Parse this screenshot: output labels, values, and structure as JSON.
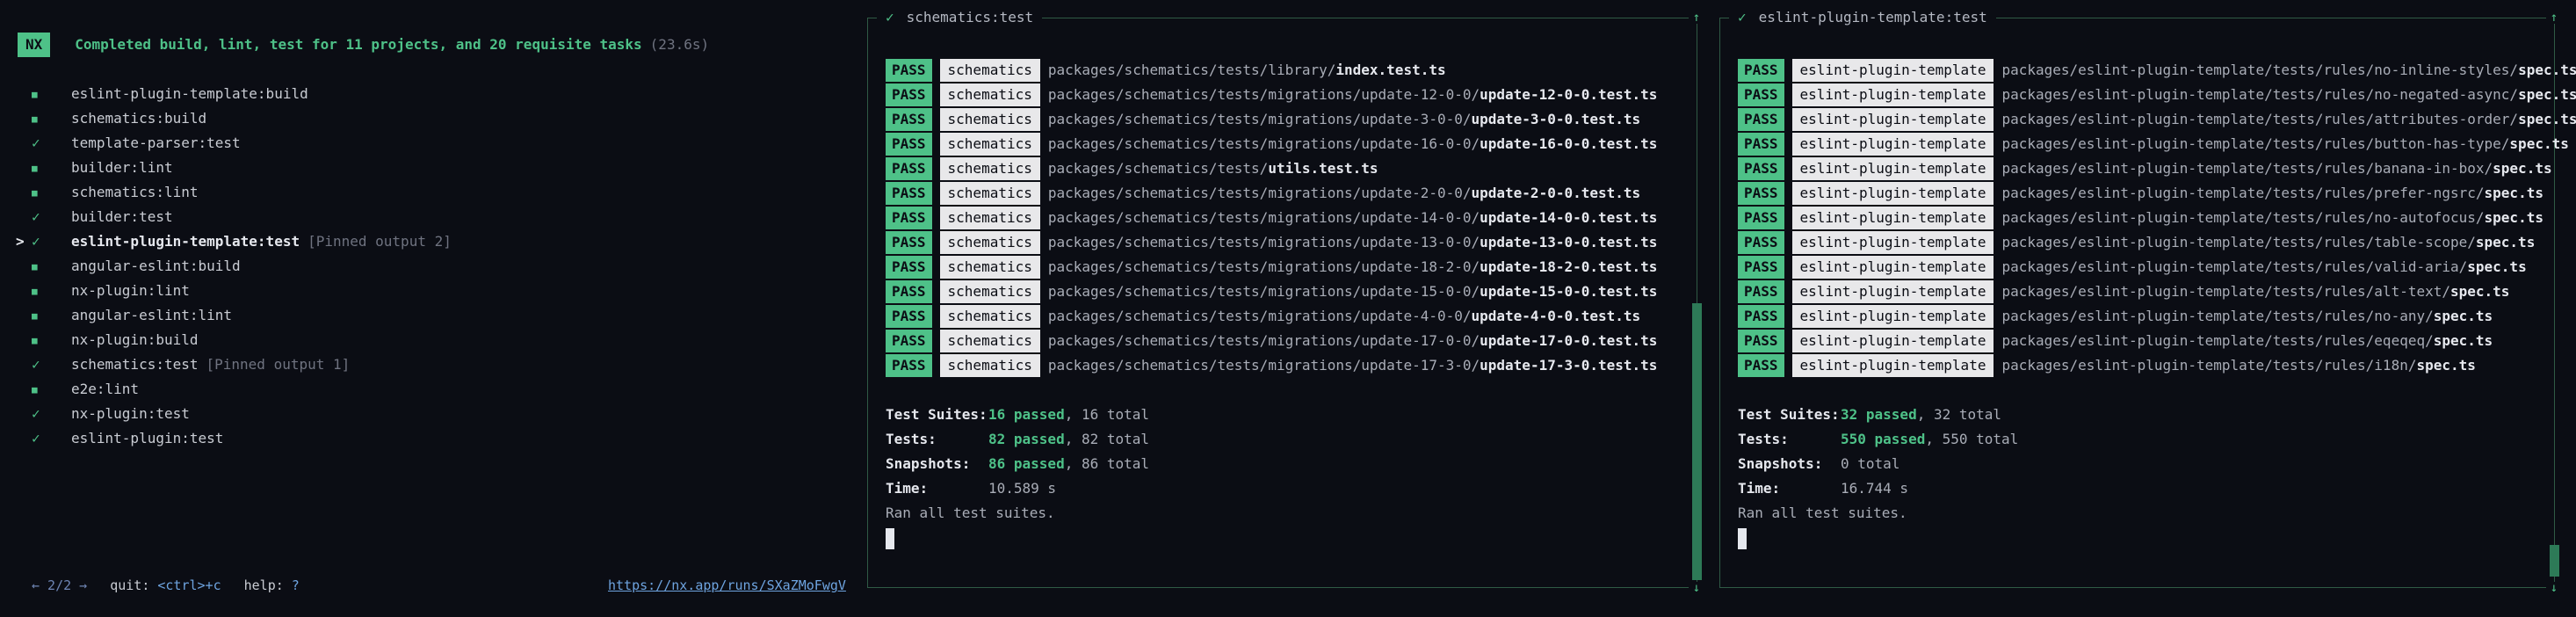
{
  "header": {
    "badge": "NX",
    "message": "Completed build, lint, test for 11 projects, and 20 requisite tasks",
    "duration": "(23.6s)"
  },
  "tasks": [
    {
      "name": "eslint-plugin-template:build",
      "status": "square",
      "pointer": "",
      "pinned": ""
    },
    {
      "name": "schematics:build",
      "status": "square",
      "pointer": "",
      "pinned": ""
    },
    {
      "name": "template-parser:test",
      "status": "check",
      "pointer": "",
      "pinned": ""
    },
    {
      "name": "builder:lint",
      "status": "square",
      "pointer": "",
      "pinned": ""
    },
    {
      "name": "schematics:lint",
      "status": "square",
      "pointer": "",
      "pinned": ""
    },
    {
      "name": "builder:test",
      "status": "check",
      "pointer": "",
      "pinned": ""
    },
    {
      "name": "eslint-plugin-template:test",
      "status": "check",
      "pointer": ">",
      "pinned": "[Pinned output 2]",
      "selected": true
    },
    {
      "name": "angular-eslint:build",
      "status": "square",
      "pointer": "",
      "pinned": ""
    },
    {
      "name": "nx-plugin:lint",
      "status": "square",
      "pointer": "",
      "pinned": ""
    },
    {
      "name": "angular-eslint:lint",
      "status": "square",
      "pointer": "",
      "pinned": ""
    },
    {
      "name": "nx-plugin:build",
      "status": "square",
      "pointer": "",
      "pinned": ""
    },
    {
      "name": "schematics:test",
      "status": "check",
      "pointer": "",
      "pinned": "[Pinned output 1]"
    },
    {
      "name": "e2e:lint",
      "status": "square",
      "pointer": "",
      "pinned": ""
    },
    {
      "name": "nx-plugin:test",
      "status": "check",
      "pointer": "",
      "pinned": ""
    },
    {
      "name": "eslint-plugin:test",
      "status": "check",
      "pointer": "",
      "pinned": ""
    }
  ],
  "footer": {
    "nav": "← 2/2 →",
    "quit_label": "quit:",
    "quit_key": "<ctrl>+c",
    "help_label": "help:",
    "help_key": "?",
    "run_url": "https://nx.app/runs/SXaZMoFwgV"
  },
  "panes": [
    {
      "title": "schematics:test",
      "scroll": {
        "up": "↑",
        "down": "↓"
      },
      "rows": [
        {
          "status": "PASS",
          "project": "schematics",
          "dir": "packages/schematics/tests/library/",
          "file": "index.test.ts"
        },
        {
          "status": "PASS",
          "project": "schematics",
          "dir": "packages/schematics/tests/migrations/update-12-0-0/",
          "file": "update-12-0-0.test.ts"
        },
        {
          "status": "PASS",
          "project": "schematics",
          "dir": "packages/schematics/tests/migrations/update-3-0-0/",
          "file": "update-3-0-0.test.ts"
        },
        {
          "status": "PASS",
          "project": "schematics",
          "dir": "packages/schematics/tests/migrations/update-16-0-0/",
          "file": "update-16-0-0.test.ts"
        },
        {
          "status": "PASS",
          "project": "schematics",
          "dir": "packages/schematics/tests/",
          "file": "utils.test.ts"
        },
        {
          "status": "PASS",
          "project": "schematics",
          "dir": "packages/schematics/tests/migrations/update-2-0-0/",
          "file": "update-2-0-0.test.ts"
        },
        {
          "status": "PASS",
          "project": "schematics",
          "dir": "packages/schematics/tests/migrations/update-14-0-0/",
          "file": "update-14-0-0.test.ts"
        },
        {
          "status": "PASS",
          "project": "schematics",
          "dir": "packages/schematics/tests/migrations/update-13-0-0/",
          "file": "update-13-0-0.test.ts"
        },
        {
          "status": "PASS",
          "project": "schematics",
          "dir": "packages/schematics/tests/migrations/update-18-2-0/",
          "file": "update-18-2-0.test.ts"
        },
        {
          "status": "PASS",
          "project": "schematics",
          "dir": "packages/schematics/tests/migrations/update-15-0-0/",
          "file": "update-15-0-0.test.ts"
        },
        {
          "status": "PASS",
          "project": "schematics",
          "dir": "packages/schematics/tests/migrations/update-4-0-0/",
          "file": "update-4-0-0.test.ts"
        },
        {
          "status": "PASS",
          "project": "schematics",
          "dir": "packages/schematics/tests/migrations/update-17-0-0/",
          "file": "update-17-0-0.test.ts"
        },
        {
          "status": "PASS",
          "project": "schematics",
          "dir": "packages/schematics/tests/migrations/update-17-3-0/",
          "file": "update-17-3-0.test.ts"
        }
      ],
      "summary": [
        {
          "label": "Test Suites:",
          "passed": "16 passed",
          "rest": ", 16 total"
        },
        {
          "label": "Tests:",
          "passed": "82 passed",
          "rest": ", 82 total"
        },
        {
          "label": "Snapshots:",
          "passed": "86 passed",
          "rest": ", 86 total"
        },
        {
          "label": "Time:",
          "passed": "",
          "rest": "10.589 s"
        }
      ],
      "ran": "Ran all test suites."
    },
    {
      "title": "eslint-plugin-template:test",
      "scroll": {
        "up": "↑",
        "down": "↓"
      },
      "rows": [
        {
          "status": "PASS",
          "project": "eslint-plugin-template",
          "dir": "packages/eslint-plugin-template/tests/rules/no-inline-styles/",
          "file": "spec.ts"
        },
        {
          "status": "PASS",
          "project": "eslint-plugin-template",
          "dir": "packages/eslint-plugin-template/tests/rules/no-negated-async/",
          "file": "spec.ts"
        },
        {
          "status": "PASS",
          "project": "eslint-plugin-template",
          "dir": "packages/eslint-plugin-template/tests/rules/attributes-order/",
          "file": "spec.ts"
        },
        {
          "status": "PASS",
          "project": "eslint-plugin-template",
          "dir": "packages/eslint-plugin-template/tests/rules/button-has-type/",
          "file": "spec.ts"
        },
        {
          "status": "PASS",
          "project": "eslint-plugin-template",
          "dir": "packages/eslint-plugin-template/tests/rules/banana-in-box/",
          "file": "spec.ts"
        },
        {
          "status": "PASS",
          "project": "eslint-plugin-template",
          "dir": "packages/eslint-plugin-template/tests/rules/prefer-ngsrc/",
          "file": "spec.ts"
        },
        {
          "status": "PASS",
          "project": "eslint-plugin-template",
          "dir": "packages/eslint-plugin-template/tests/rules/no-autofocus/",
          "file": "spec.ts"
        },
        {
          "status": "PASS",
          "project": "eslint-plugin-template",
          "dir": "packages/eslint-plugin-template/tests/rules/table-scope/",
          "file": "spec.ts"
        },
        {
          "status": "PASS",
          "project": "eslint-plugin-template",
          "dir": "packages/eslint-plugin-template/tests/rules/valid-aria/",
          "file": "spec.ts"
        },
        {
          "status": "PASS",
          "project": "eslint-plugin-template",
          "dir": "packages/eslint-plugin-template/tests/rules/alt-text/",
          "file": "spec.ts"
        },
        {
          "status": "PASS",
          "project": "eslint-plugin-template",
          "dir": "packages/eslint-plugin-template/tests/rules/no-any/",
          "file": "spec.ts"
        },
        {
          "status": "PASS",
          "project": "eslint-plugin-template",
          "dir": "packages/eslint-plugin-template/tests/rules/eqeqeq/",
          "file": "spec.ts"
        },
        {
          "status": "PASS",
          "project": "eslint-plugin-template",
          "dir": "packages/eslint-plugin-template/tests/rules/i18n/",
          "file": "spec.ts"
        }
      ],
      "summary": [
        {
          "label": "Test Suites:",
          "passed": "32 passed",
          "rest": ", 32 total"
        },
        {
          "label": "Tests:",
          "passed": "550 passed",
          "rest": ", 550 total"
        },
        {
          "label": "Snapshots:",
          "passed": "",
          "rest": "0 total"
        },
        {
          "label": "Time:",
          "passed": "",
          "rest": "16.744 s"
        }
      ],
      "ran": "Ran all test suites."
    }
  ],
  "colors": {
    "background": "#0b0d14",
    "accent": "#4ec188",
    "border": "#2f5a45",
    "link": "#6ea4e0"
  }
}
